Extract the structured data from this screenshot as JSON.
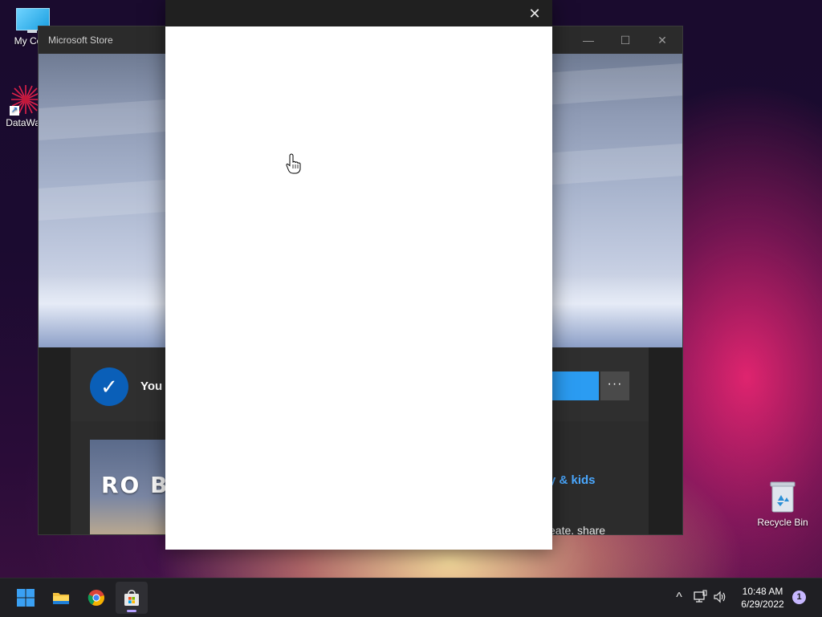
{
  "desktop": {
    "icons": [
      {
        "label": "My Com",
        "icon": "computer-icon"
      },
      {
        "label": "DataWag",
        "icon": "datawag-app-icon"
      },
      {
        "label": "Recycle Bin",
        "icon": "recycle-bin-icon"
      }
    ]
  },
  "store_window": {
    "title": "Microsoft Store",
    "controls": {
      "minimize": "—",
      "maximize": "☐",
      "close": "✕"
    },
    "install_status": "You c",
    "more_button": "···",
    "game_logo_text": "RO B",
    "category_link": "y & kids",
    "description_fragment": "eate, share"
  },
  "dialog": {
    "close_icon": "✕"
  },
  "taskbar": {
    "apps": [
      {
        "name": "Start",
        "icon": "windows-start-icon"
      },
      {
        "name": "File Explorer",
        "icon": "file-explorer-icon"
      },
      {
        "name": "Google Chrome",
        "icon": "chrome-icon"
      },
      {
        "name": "Microsoft Store",
        "icon": "microsoft-store-icon",
        "active": true
      }
    ],
    "tray": {
      "chevron": "^",
      "time": "10:48 AM",
      "date": "6/29/2022",
      "notification_count": "1"
    }
  },
  "colors": {
    "accent_blue": "#2b9cf2",
    "check_blue": "#0a5fb8",
    "link_blue": "#4aa8ff",
    "indicator": "#b5a1ff"
  }
}
